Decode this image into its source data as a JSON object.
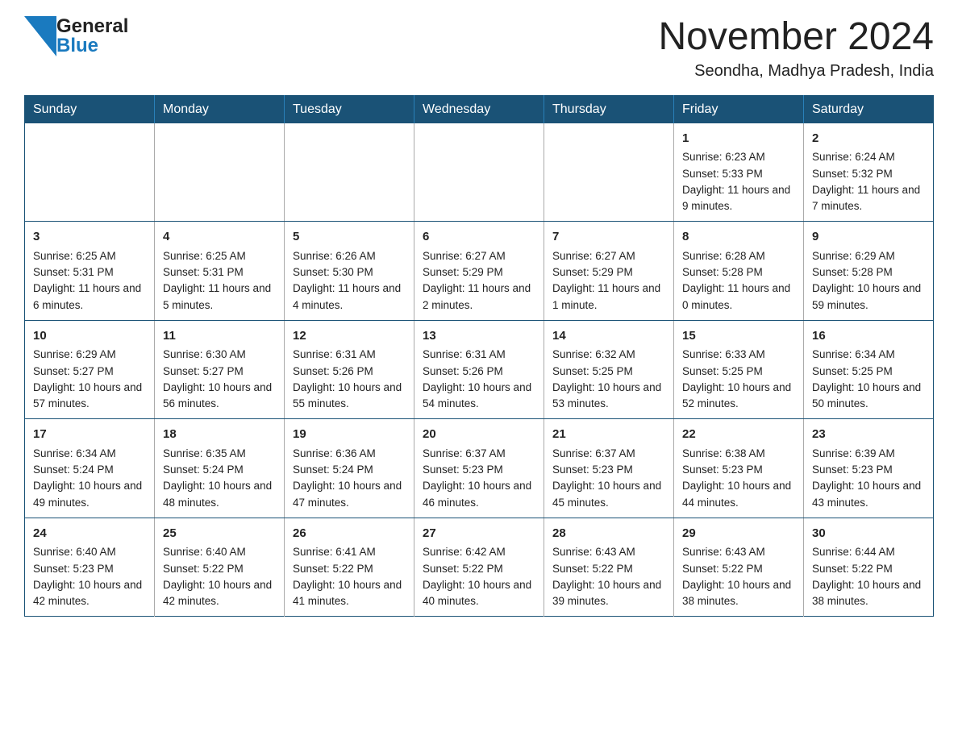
{
  "header": {
    "logo_general": "General",
    "logo_blue": "Blue",
    "month_title": "November 2024",
    "subtitle": "Seondha, Madhya Pradesh, India"
  },
  "days_of_week": [
    "Sunday",
    "Monday",
    "Tuesday",
    "Wednesday",
    "Thursday",
    "Friday",
    "Saturday"
  ],
  "weeks": [
    {
      "days": [
        {
          "number": "",
          "info": ""
        },
        {
          "number": "",
          "info": ""
        },
        {
          "number": "",
          "info": ""
        },
        {
          "number": "",
          "info": ""
        },
        {
          "number": "",
          "info": ""
        },
        {
          "number": "1",
          "info": "Sunrise: 6:23 AM\nSunset: 5:33 PM\nDaylight: 11 hours and 9 minutes."
        },
        {
          "number": "2",
          "info": "Sunrise: 6:24 AM\nSunset: 5:32 PM\nDaylight: 11 hours and 7 minutes."
        }
      ]
    },
    {
      "days": [
        {
          "number": "3",
          "info": "Sunrise: 6:25 AM\nSunset: 5:31 PM\nDaylight: 11 hours and 6 minutes."
        },
        {
          "number": "4",
          "info": "Sunrise: 6:25 AM\nSunset: 5:31 PM\nDaylight: 11 hours and 5 minutes."
        },
        {
          "number": "5",
          "info": "Sunrise: 6:26 AM\nSunset: 5:30 PM\nDaylight: 11 hours and 4 minutes."
        },
        {
          "number": "6",
          "info": "Sunrise: 6:27 AM\nSunset: 5:29 PM\nDaylight: 11 hours and 2 minutes."
        },
        {
          "number": "7",
          "info": "Sunrise: 6:27 AM\nSunset: 5:29 PM\nDaylight: 11 hours and 1 minute."
        },
        {
          "number": "8",
          "info": "Sunrise: 6:28 AM\nSunset: 5:28 PM\nDaylight: 11 hours and 0 minutes."
        },
        {
          "number": "9",
          "info": "Sunrise: 6:29 AM\nSunset: 5:28 PM\nDaylight: 10 hours and 59 minutes."
        }
      ]
    },
    {
      "days": [
        {
          "number": "10",
          "info": "Sunrise: 6:29 AM\nSunset: 5:27 PM\nDaylight: 10 hours and 57 minutes."
        },
        {
          "number": "11",
          "info": "Sunrise: 6:30 AM\nSunset: 5:27 PM\nDaylight: 10 hours and 56 minutes."
        },
        {
          "number": "12",
          "info": "Sunrise: 6:31 AM\nSunset: 5:26 PM\nDaylight: 10 hours and 55 minutes."
        },
        {
          "number": "13",
          "info": "Sunrise: 6:31 AM\nSunset: 5:26 PM\nDaylight: 10 hours and 54 minutes."
        },
        {
          "number": "14",
          "info": "Sunrise: 6:32 AM\nSunset: 5:25 PM\nDaylight: 10 hours and 53 minutes."
        },
        {
          "number": "15",
          "info": "Sunrise: 6:33 AM\nSunset: 5:25 PM\nDaylight: 10 hours and 52 minutes."
        },
        {
          "number": "16",
          "info": "Sunrise: 6:34 AM\nSunset: 5:25 PM\nDaylight: 10 hours and 50 minutes."
        }
      ]
    },
    {
      "days": [
        {
          "number": "17",
          "info": "Sunrise: 6:34 AM\nSunset: 5:24 PM\nDaylight: 10 hours and 49 minutes."
        },
        {
          "number": "18",
          "info": "Sunrise: 6:35 AM\nSunset: 5:24 PM\nDaylight: 10 hours and 48 minutes."
        },
        {
          "number": "19",
          "info": "Sunrise: 6:36 AM\nSunset: 5:24 PM\nDaylight: 10 hours and 47 minutes."
        },
        {
          "number": "20",
          "info": "Sunrise: 6:37 AM\nSunset: 5:23 PM\nDaylight: 10 hours and 46 minutes."
        },
        {
          "number": "21",
          "info": "Sunrise: 6:37 AM\nSunset: 5:23 PM\nDaylight: 10 hours and 45 minutes."
        },
        {
          "number": "22",
          "info": "Sunrise: 6:38 AM\nSunset: 5:23 PM\nDaylight: 10 hours and 44 minutes."
        },
        {
          "number": "23",
          "info": "Sunrise: 6:39 AM\nSunset: 5:23 PM\nDaylight: 10 hours and 43 minutes."
        }
      ]
    },
    {
      "days": [
        {
          "number": "24",
          "info": "Sunrise: 6:40 AM\nSunset: 5:23 PM\nDaylight: 10 hours and 42 minutes."
        },
        {
          "number": "25",
          "info": "Sunrise: 6:40 AM\nSunset: 5:22 PM\nDaylight: 10 hours and 42 minutes."
        },
        {
          "number": "26",
          "info": "Sunrise: 6:41 AM\nSunset: 5:22 PM\nDaylight: 10 hours and 41 minutes."
        },
        {
          "number": "27",
          "info": "Sunrise: 6:42 AM\nSunset: 5:22 PM\nDaylight: 10 hours and 40 minutes."
        },
        {
          "number": "28",
          "info": "Sunrise: 6:43 AM\nSunset: 5:22 PM\nDaylight: 10 hours and 39 minutes."
        },
        {
          "number": "29",
          "info": "Sunrise: 6:43 AM\nSunset: 5:22 PM\nDaylight: 10 hours and 38 minutes."
        },
        {
          "number": "30",
          "info": "Sunrise: 6:44 AM\nSunset: 5:22 PM\nDaylight: 10 hours and 38 minutes."
        }
      ]
    }
  ]
}
